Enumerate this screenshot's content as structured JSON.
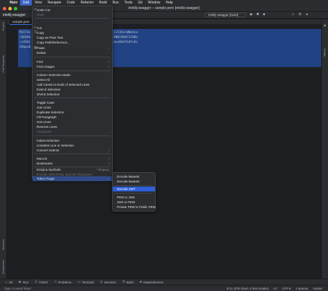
{
  "menubar": {
    "items": [
      "Main",
      "Edit",
      "View",
      "Navigate",
      "Code",
      "Refactor",
      "Build",
      "Run",
      "Tools",
      "Git",
      "Window",
      "Help"
    ],
    "active": "Edit"
  },
  "titlebar": {
    "title": "intellij-swagger – sample.pem [intellij-swagger]",
    "colors": {
      "close": "#ff5f57",
      "minimize": "#febc2e",
      "zoom": "#28c840"
    }
  },
  "toolbar": {
    "project": "intellij-swagger",
    "run_config": "intellij-swagger [build]"
  },
  "editor": {
    "tab": "sample.pem",
    "lines_left": [
      "MIIFHz",
      "CQEBAQ",
      "ccVVUL",
      "ZHgwuB"
    ],
    "lines_right": [
      "IiFZk3rWNk9ce",
      "8NB19U0F2F8Bo",
      "dxe6Kd7k8fxHc"
    ]
  },
  "edit_menu": {
    "items": [
      {
        "label": "Undo Cut",
        "shortcut": "",
        "submenu": false,
        "disabled": false
      },
      {
        "label": "Redo",
        "shortcut": "",
        "submenu": false,
        "disabled": true
      },
      {
        "label": "Cut",
        "shortcut": "",
        "submenu": false,
        "disabled": false
      },
      {
        "label": "Copy",
        "shortcut": "",
        "submenu": false,
        "disabled": false
      },
      {
        "label": "Copy as Plain Text",
        "shortcut": "",
        "submenu": false,
        "disabled": false
      },
      {
        "label": "Copy Path/Reference...",
        "shortcut": "",
        "submenu": false,
        "disabled": false
      },
      {
        "label": "Paste",
        "shortcut": "",
        "submenu": true,
        "disabled": false
      },
      {
        "label": "Delete",
        "shortcut": "",
        "submenu": false,
        "disabled": false
      },
      {
        "label": "Find",
        "shortcut": "",
        "submenu": true,
        "disabled": false
      },
      {
        "label": "Find Usages",
        "shortcut": "",
        "submenu": true,
        "disabled": false
      },
      {
        "label": "Column Selection Mode",
        "shortcut": "",
        "submenu": false,
        "disabled": false
      },
      {
        "label": "Select All",
        "shortcut": "",
        "submenu": false,
        "disabled": false
      },
      {
        "label": "Add Carets to Ends of Selected Lines",
        "shortcut": "",
        "submenu": false,
        "disabled": false
      },
      {
        "label": "Extend Selection",
        "shortcut": "",
        "submenu": false,
        "disabled": false
      },
      {
        "label": "Shrink Selection",
        "shortcut": "",
        "submenu": false,
        "disabled": false
      },
      {
        "label": "Toggle Case",
        "shortcut": "",
        "submenu": false,
        "disabled": false
      },
      {
        "label": "Join Lines",
        "shortcut": "",
        "submenu": false,
        "disabled": false
      },
      {
        "label": "Duplicate Selection",
        "shortcut": "",
        "submenu": false,
        "disabled": false
      },
      {
        "label": "Fill Paragraph",
        "shortcut": "",
        "submenu": false,
        "disabled": false
      },
      {
        "label": "Sort Lines",
        "shortcut": "",
        "submenu": false,
        "disabled": false
      },
      {
        "label": "Reverse Lines",
        "shortcut": "",
        "submenu": false,
        "disabled": false
      },
      {
        "label": "Transpose",
        "shortcut": "",
        "submenu": false,
        "disabled": true
      },
      {
        "label": "Indent Selection",
        "shortcut": "",
        "submenu": false,
        "disabled": false
      },
      {
        "label": "Unindent Line or Selection",
        "shortcut": "",
        "submenu": false,
        "disabled": false
      },
      {
        "label": "Convert Indents",
        "shortcut": "",
        "submenu": true,
        "disabled": false
      },
      {
        "label": "Macros",
        "shortcut": "",
        "submenu": true,
        "disabled": false
      },
      {
        "label": "Bookmarks",
        "shortcut": "",
        "submenu": true,
        "disabled": false
      },
      {
        "label": "Emoji & Symbols",
        "shortcut": "^ ⌘Space",
        "submenu": false,
        "disabled": false
      },
      {
        "label": "Encode XML/HTML Special Characters",
        "shortcut": "",
        "submenu": false,
        "disabled": true
      },
      {
        "label": "Token Forge",
        "shortcut": "",
        "submenu": true,
        "disabled": false
      }
    ]
  },
  "token_forge_menu": {
    "items": [
      {
        "label": "Encode Base64"
      },
      {
        "label": "Decode Base64"
      },
      {
        "label": "Decode JWT"
      },
      {
        "label": "PEM to JWK"
      },
      {
        "label": "JWK to PEM"
      },
      {
        "label": "Private PEM to Public PEM"
      }
    ],
    "selected": "Decode JWT"
  },
  "bottombar": {
    "items": [
      "Git",
      "Run",
      "TODO",
      "Problems",
      "Terminal",
      "Services",
      "Build",
      "Dependencies"
    ]
  },
  "statusbar": {
    "message": "Typo: In word 'Ileav'",
    "position": "8:11 (378 chars, 6 line breaks)",
    "line_sep": "LF",
    "encoding": "UTF-8",
    "indent": "4 spaces",
    "branch": "master"
  },
  "side": {
    "left": [
      "Project",
      "Pull Requests",
      "Structure",
      "Bookmarks"
    ],
    "right": [
      "Gradle"
    ]
  }
}
